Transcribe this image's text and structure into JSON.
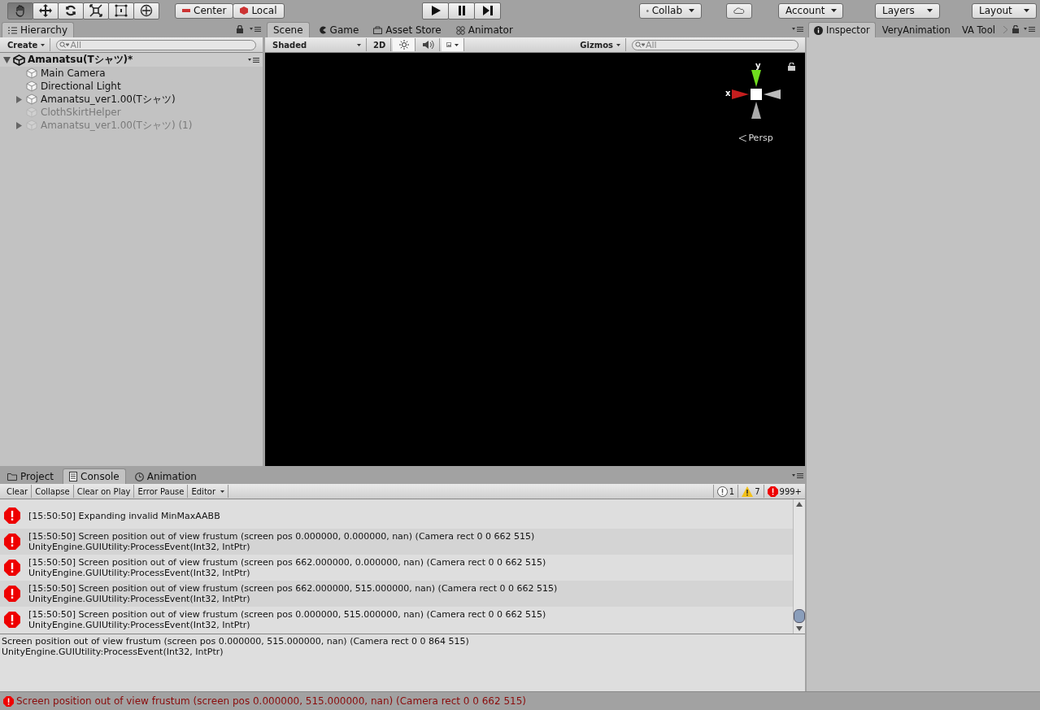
{
  "toolbar": {
    "tools": [
      {
        "kind": "hand",
        "selected": true
      },
      {
        "kind": "move",
        "selected": false
      },
      {
        "kind": "rotate",
        "selected": false
      },
      {
        "kind": "scale",
        "selected": false
      },
      {
        "kind": "rect",
        "selected": false
      },
      {
        "kind": "transform",
        "selected": false
      }
    ],
    "pivot": [
      "Center",
      "Local"
    ],
    "play": [
      {
        "kind": "play"
      },
      {
        "kind": "pause"
      },
      {
        "kind": "step"
      }
    ],
    "collab": "Collab",
    "account": "Account",
    "layers": "Layers",
    "layout": "Layout"
  },
  "hierarchy": {
    "tab": "Hierarchy",
    "create": "Create",
    "search": {
      "placeholder": "All"
    },
    "scene": "Amanatsu(Tシャツ)*",
    "items": [
      {
        "label": "Main Camera",
        "expandable": false,
        "disabled": false
      },
      {
        "label": "Directional Light",
        "expandable": false,
        "disabled": false
      },
      {
        "label": "Amanatsu_ver1.00(Tシャツ)",
        "expandable": true,
        "disabled": false
      },
      {
        "label": "ClothSkirtHelper",
        "expandable": false,
        "disabled": true
      },
      {
        "label": "Amanatsu_ver1.00(Tシャツ) (1)",
        "expandable": true,
        "disabled": true
      }
    ]
  },
  "scene": {
    "tabs": [
      {
        "label": "Scene",
        "kind": "scene",
        "selected": true
      },
      {
        "label": "Game",
        "kind": "game",
        "selected": false
      },
      {
        "label": "Asset Store",
        "kind": "store",
        "selected": false
      },
      {
        "label": "Animator",
        "kind": "animator",
        "selected": false
      }
    ],
    "shading": "Shaded",
    "mode_2d": "2D",
    "lighting_on": true,
    "audio_on": false,
    "effects_on": true,
    "gizmos": "Gizmos",
    "search": {
      "placeholder": "All"
    },
    "axis_y": "y",
    "axis_x": "x",
    "projection": "Persp"
  },
  "inspector": {
    "tabs": [
      {
        "label": "Inspector",
        "selected": true
      },
      {
        "label": "VeryAnimation",
        "selected": false
      },
      {
        "label": "VA Tool",
        "selected": false
      }
    ]
  },
  "console": {
    "tabs": [
      {
        "label": "Project",
        "kind": "folder",
        "selected": false
      },
      {
        "label": "Console",
        "kind": "console",
        "selected": true
      },
      {
        "label": "Animation",
        "kind": "clock",
        "selected": false
      }
    ],
    "buttons": [
      {
        "label": "Clear",
        "kind": "button"
      },
      {
        "label": "Collapse",
        "kind": "button"
      },
      {
        "label": "Clear on Play",
        "kind": "button"
      },
      {
        "label": "Error Pause",
        "kind": "button"
      },
      {
        "label": "Editor",
        "kind": "dropdown"
      }
    ],
    "counts": [
      {
        "kind": "info",
        "count": "1"
      },
      {
        "kind": "warning",
        "count": "7"
      },
      {
        "kind": "error",
        "count": "999+"
      }
    ],
    "logs": [
      {
        "lines": [
          "[15:50:50] Expanding invalid MinMaxAABB"
        ]
      },
      {
        "lines": [
          "[15:50:50] Screen position out of view frustum (screen pos 0.000000, 0.000000, nan) (Camera rect 0 0 662 515)",
          "UnityEngine.GUIUtility:ProcessEvent(Int32, IntPtr)"
        ]
      },
      {
        "lines": [
          "[15:50:50] Screen position out of view frustum (screen pos 662.000000, 0.000000, nan) (Camera rect 0 0 662 515)",
          "UnityEngine.GUIUtility:ProcessEvent(Int32, IntPtr)"
        ]
      },
      {
        "lines": [
          "[15:50:50] Screen position out of view frustum (screen pos 662.000000, 515.000000, nan) (Camera rect 0 0 662 515)",
          "UnityEngine.GUIUtility:ProcessEvent(Int32, IntPtr)"
        ]
      },
      {
        "lines": [
          "[15:50:50] Screen position out of view frustum (screen pos 0.000000, 515.000000, nan) (Camera rect 0 0 662 515)",
          "UnityEngine.GUIUtility:ProcessEvent(Int32, IntPtr)"
        ]
      }
    ],
    "detail": [
      "Screen position out of view frustum (screen pos 0.000000, 515.000000, nan) (Camera rect 0 0 864 515)",
      "UnityEngine.GUIUtility:ProcessEvent(Int32, IntPtr)"
    ]
  },
  "status_bar": "Screen position out of view frustum (screen pos 0.000000, 515.000000, nan) (Camera rect 0 0 662 515)"
}
